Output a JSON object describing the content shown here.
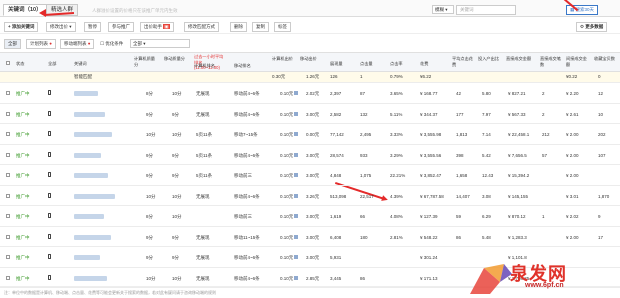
{
  "tabs": [
    {
      "label": "关键词（10）"
    },
    {
      "label": "精选人群"
    }
  ],
  "hint": "人群溢价设置的价格只在该推广单元内生效",
  "search": {
    "match_select": "模糊",
    "placeholder": "关键词",
    "result_btn": "搜索30天"
  },
  "toolbar": {
    "add": "添加关键词",
    "edit_price": "修改出价",
    "pause": "暂停",
    "resume": "参与推广",
    "smart": "出价助手",
    "match_mode": "修改匹配方式",
    "delete": "删除",
    "copy": "复制",
    "tag": "标签",
    "more": "更多数据"
  },
  "toolbar2": {
    "filter_all": "全部",
    "filter_plan": "计划列表",
    "filter_mobile": "移动端列表",
    "date_label": "优化条件",
    "date_value": "全部"
  },
  "headers": [
    "状态",
    "全部",
    "关键词",
    "计算机质量分",
    "移动质量分",
    "计算机排名",
    "移动排名",
    "计算机出价",
    "移动出价",
    "展现量",
    "点击量",
    "点击率",
    "花费",
    "平均点击花费",
    "投入产出比",
    "直接成交金额",
    "直接成交笔数",
    "间接成交金额",
    "收藏宝贝数"
  ],
  "header_note": "过去一小时平均排名(11:00~12:00)",
  "summary": {
    "name": "智能匹配",
    "pc_bid": "0.30元",
    "m_bid": "1.26元",
    "impressions": "126",
    "clicks": "1",
    "ctr": "0.79%",
    "cost": "¥6.22",
    "cpc": "",
    "roi": "",
    "gmv": "",
    "orders": "",
    "gmv2": "¥0.22",
    "fav": "0"
  },
  "rows": [
    {
      "status": "推广中",
      "pc": "8分",
      "m": "10分",
      "pc_rank": "无展现",
      "m_rank": "移动前4~6条",
      "pc_bid": "0.10元",
      "m_bid": "2.02元",
      "imp": "2,397",
      "clk": "87",
      "ctr": "3.65%",
      "cost": "¥ 168.77",
      "cpc": "42",
      "roi": "5.80",
      "gmv": "¥ 827.21",
      "ord": "2",
      "gmv2": "¥ 2.20",
      "fav": "12"
    },
    {
      "status": "推广中",
      "pc": "9分",
      "m": "9分",
      "pc_rank": "无展现",
      "m_rank": "移动前4~6条",
      "pc_bid": "0.10元",
      "m_bid": "3.00元",
      "imp": "2,582",
      "clk": "132",
      "ctr": "5.11%",
      "cost": "¥ 344.37",
      "cpc": "177",
      "roi": "7.97",
      "gmv": "¥ 567.33",
      "ord": "2",
      "gmv2": "¥ 2.61",
      "fav": "10"
    },
    {
      "status": "推广中",
      "pc": "10分",
      "m": "10分",
      "pc_rank": "5页11条",
      "m_rank": "移动7~15条",
      "pc_bid": "0.10元",
      "m_bid": "0.00元",
      "imp": "77,142",
      "clk": "2,495",
      "ctr": "3.33%",
      "cost": "¥ 3,555.98",
      "cpc": "1,813",
      "roi": "7.14",
      "gmv": "¥ 22,458.1",
      "ord": "212",
      "gmv2": "¥ 2.00",
      "fav": "202"
    },
    {
      "status": "推广中",
      "pc": "9分",
      "m": "9分",
      "pc_rank": "5页11条",
      "m_rank": "移动前4~6条",
      "pc_bid": "0.10元",
      "m_bid": "3.00元",
      "imp": "28,574",
      "clk": "933",
      "ctr": "3.29%",
      "cost": "¥ 3,555.56",
      "cpc": "398",
      "roi": "5.42",
      "gmv": "¥ 7,656.5",
      "ord": "57",
      "gmv2": "¥ 2.00",
      "fav": "107"
    },
    {
      "status": "推广中",
      "pc": "9分",
      "m": "9分",
      "pc_rank": "5页11条",
      "m_rank": "移动前三",
      "pc_bid": "0.10元",
      "m_bid": "3.00元",
      "imp": "4,848",
      "clk": "1,075",
      "ctr": "22.21%",
      "cost": "¥ 3,852.47",
      "cpc": "1,658",
      "roi": "12.43",
      "gmv": "¥ 15,394.2",
      "ord": "",
      "gmv2": "¥ 2.00",
      "fav": ""
    },
    {
      "status": "推广中",
      "pc": "10分",
      "m": "10分",
      "pc_rank": "无展现",
      "m_rank": "移动前4~6条",
      "pc_bid": "0.10元",
      "m_bid": "3.26元",
      "imp": "513,098",
      "clk": "22,517",
      "ctr": "4.39%",
      "cost": "¥ 67,787.58",
      "cpc": "14,407",
      "roi": "3.08",
      "gmv": "¥ 145,155",
      "ord": "",
      "gmv2": "¥ 3.01",
      "fav": "1,870"
    },
    {
      "status": "推广中",
      "pc": "8分",
      "m": "10分",
      "pc_rank": "",
      "m_rank": "移动前三",
      "pc_bid": "0.10元",
      "m_bid": "3.00元",
      "imp": "1,619",
      "clk": "66",
      "ctr": "4.08%",
      "cost": "¥ 127.39",
      "cpc": "59",
      "roi": "6.29",
      "gmv": "¥ 870.12",
      "ord": "1",
      "gmv2": "¥ 2.02",
      "fav": "9"
    },
    {
      "status": "推广中",
      "pc": "9分",
      "m": "9分",
      "pc_rank": "无展现",
      "m_rank": "移动11~15条",
      "pc_bid": "0.10元",
      "m_bid": "3.00元",
      "imp": "6,408",
      "clk": "180",
      "ctr": "2.81%",
      "cost": "¥ 548.22",
      "cpc": "86",
      "roi": "5.48",
      "gmv": "¥ 1,283.3",
      "ord": "",
      "gmv2": "¥ 2.00",
      "fav": "17"
    },
    {
      "status": "推广中",
      "pc": "9分",
      "m": "9分",
      "pc_rank": "无展现",
      "m_rank": "移动前4~6条",
      "pc_bid": "0.10元",
      "m_bid": "3.00元",
      "imp": "5,931",
      "clk": "",
      "ctr": "",
      "cost": "¥ 301.24",
      "cpc": "",
      "roi": "",
      "gmv": "¥ 1,101.8",
      "ord": "",
      "gmv2": "",
      "fav": ""
    },
    {
      "status": "推广中",
      "pc": "10分",
      "m": "10分",
      "pc_rank": "无展现",
      "m_rank": "移动前4~6条",
      "pc_bid": "0.10元",
      "m_bid": "2.85元",
      "imp": "3,445",
      "clk": "86",
      "ctr": "",
      "cost": "¥ 171.13",
      "cpc": "",
      "roi": "",
      "gmv": "¥ 1,708.35",
      "ord": "",
      "gmv2": "",
      "fav": ""
    }
  ],
  "footer": "注：单位中的数据是计算机、移动端、点击量、花费等可能会更新关于搜索的数据，若对此有疑问请于咨询移动端的规则",
  "watermark": {
    "brand": "泉发网",
    "url": "www.6pf.cn"
  },
  "colors": {
    "status_green": "#3c9a2a",
    "link_blue": "#3a78c8",
    "arrow_red": "#e42a2a"
  }
}
